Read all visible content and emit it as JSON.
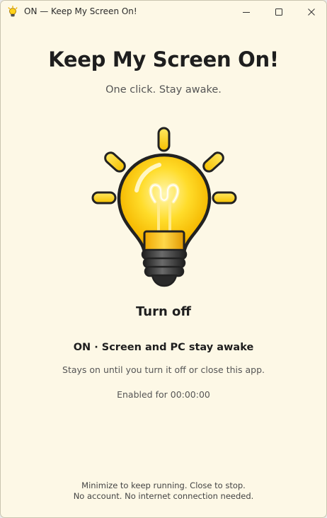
{
  "window": {
    "title": "ON — Keep My Screen On!"
  },
  "main": {
    "heading": "Keep My Screen On!",
    "tagline": "One click. Stay awake.",
    "toggle_label": "Turn off",
    "status": "ON · Screen and PC stay awake",
    "status_detail": "Stays on until you turn it off or close this app.",
    "timer_text": "Enabled for 00:00:00"
  },
  "footer": {
    "line1": "Minimize to keep running. Close to stop.",
    "line2": "No account. No internet connection needed."
  },
  "icons": {
    "app": "lightbulb-icon",
    "minimize": "minimize-icon",
    "maximize": "maximize-icon",
    "close": "close-icon",
    "bulb": "lightbulb-on-icon"
  },
  "colors": {
    "background": "#fdf8e6",
    "bulb_glass": "#ffd21a",
    "bulb_glow": "#fff6a8",
    "rays": "#ffd400",
    "base": "#2b2b2b",
    "text": "#1e1e1e",
    "muted": "#555555"
  }
}
